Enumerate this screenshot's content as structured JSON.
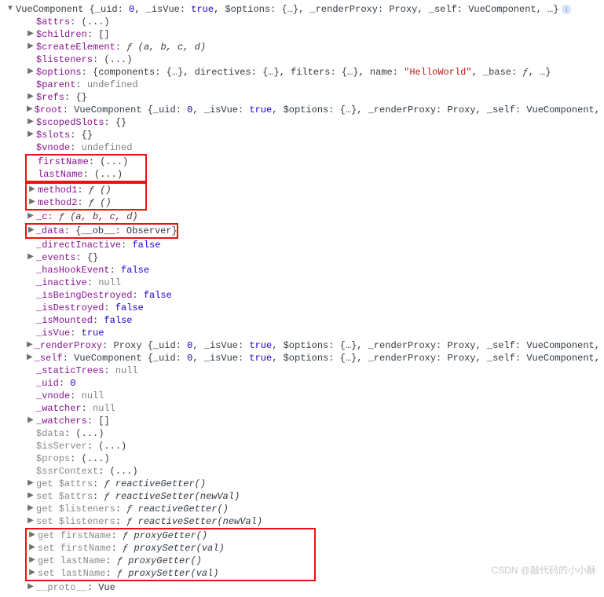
{
  "watermark": "CSDN @敲代码的小小酥",
  "header": {
    "name": "VueComponent",
    "parts": [
      {
        "k": "_uid",
        "v": "0",
        "cls": "num"
      },
      {
        "k": "_isVue",
        "v": "true",
        "cls": "bool"
      },
      {
        "k": "$options",
        "v": "{…}",
        "cls": "val"
      },
      {
        "k": "_renderProxy",
        "v": "Proxy",
        "cls": "val"
      },
      {
        "k": "_self",
        "v": "VueComponent",
        "cls": "val"
      }
    ],
    "tail": ", …}"
  },
  "pre": [
    {
      "arrow": "none",
      "k": "$attrs",
      "v": "(...)",
      "kcls": "prop",
      "vcls": "val"
    },
    {
      "arrow": "right",
      "k": "$children",
      "v": "[]",
      "kcls": "prop",
      "vcls": "val"
    },
    {
      "arrow": "right",
      "k": "$createElement",
      "render": "fn",
      "sig": "(a, b, c, d)",
      "kcls": "prop"
    },
    {
      "arrow": "none",
      "k": "$listeners",
      "v": "(...)",
      "kcls": "prop",
      "vcls": "val"
    },
    {
      "arrow": "right",
      "k": "$options",
      "render": "options",
      "kcls": "prop"
    },
    {
      "arrow": "none",
      "k": "$parent",
      "v": "undefined",
      "kcls": "prop",
      "vcls": "nul"
    },
    {
      "arrow": "right",
      "k": "$refs",
      "v": "{}",
      "kcls": "prop",
      "vcls": "val"
    },
    {
      "arrow": "right",
      "k": "$root",
      "render": "vuecomp",
      "kcls": "prop"
    },
    {
      "arrow": "right",
      "k": "$scopedSlots",
      "v": "{}",
      "kcls": "prop",
      "vcls": "val"
    },
    {
      "arrow": "right",
      "k": "$slots",
      "v": "{}",
      "kcls": "prop",
      "vcls": "val"
    },
    {
      "arrow": "none",
      "k": "$vnode",
      "v": "undefined",
      "kcls": "prop",
      "vcls": "nul"
    }
  ],
  "options": {
    "parts": [
      {
        "k": "components",
        "v": "{…}"
      },
      {
        "k": "directives",
        "v": "{…}"
      },
      {
        "k": "filters",
        "v": "{…}"
      },
      {
        "k": "name",
        "v": "\"HelloWorld\"",
        "cls": "str"
      },
      {
        "k": "_base",
        "v": "ƒ",
        "cls": "fn"
      }
    ],
    "tail": ", …}"
  },
  "vuecomp": {
    "name": "VueComponent",
    "parts": [
      {
        "k": "_uid",
        "v": "0",
        "cls": "num"
      },
      {
        "k": "_isVue",
        "v": "true",
        "cls": "bool"
      },
      {
        "k": "$options",
        "v": "{…}",
        "cls": "val"
      },
      {
        "k": "_renderProxy",
        "v": "Proxy",
        "cls": "val"
      },
      {
        "k": "_self",
        "v": "VueComponent",
        "cls": "val"
      }
    ],
    "tail": ", …}"
  },
  "box1": [
    {
      "arrow": "none",
      "k": "firstName",
      "v": "(...)",
      "kcls": "prop",
      "vcls": "val"
    },
    {
      "arrow": "none",
      "k": "lastName",
      "v": "(...)",
      "kcls": "prop",
      "vcls": "val"
    }
  ],
  "box2": [
    {
      "arrow": "right",
      "k": "method1",
      "render": "fn",
      "sig": "()",
      "kcls": "prop"
    },
    {
      "arrow": "right",
      "k": "method2",
      "render": "fn",
      "sig": "()",
      "kcls": "prop"
    }
  ],
  "mid1": [
    {
      "arrow": "right",
      "k": "_c",
      "render": "fn",
      "sig": "(a, b, c, d)",
      "kcls": "prop"
    }
  ],
  "box3": [
    {
      "arrow": "right",
      "k": "_data",
      "v": "{__ob__: Observer}",
      "kcls": "prop",
      "vcls": "val"
    }
  ],
  "mid2": [
    {
      "arrow": "none",
      "k": "_directInactive",
      "v": "false",
      "kcls": "prop",
      "vcls": "bool"
    },
    {
      "arrow": "right",
      "k": "_events",
      "v": "{}",
      "kcls": "prop",
      "vcls": "val"
    },
    {
      "arrow": "none",
      "k": "_hasHookEvent",
      "v": "false",
      "kcls": "prop",
      "vcls": "bool"
    },
    {
      "arrow": "none",
      "k": "_inactive",
      "v": "null",
      "kcls": "prop",
      "vcls": "nul"
    },
    {
      "arrow": "none",
      "k": "_isBeingDestroyed",
      "v": "false",
      "kcls": "prop",
      "vcls": "bool"
    },
    {
      "arrow": "none",
      "k": "_isDestroyed",
      "v": "false",
      "kcls": "prop",
      "vcls": "bool"
    },
    {
      "arrow": "none",
      "k": "_isMounted",
      "v": "false",
      "kcls": "prop",
      "vcls": "bool"
    },
    {
      "arrow": "none",
      "k": "_isVue",
      "v": "true",
      "kcls": "prop",
      "vcls": "bool"
    },
    {
      "arrow": "right",
      "k": "_renderProxy",
      "render": "proxycomp",
      "kcls": "prop"
    },
    {
      "arrow": "right",
      "k": "_self",
      "render": "vuecomp",
      "kcls": "prop"
    },
    {
      "arrow": "none",
      "k": "_staticTrees",
      "v": "null",
      "kcls": "prop",
      "vcls": "nul"
    },
    {
      "arrow": "none",
      "k": "_uid",
      "v": "0",
      "kcls": "prop",
      "vcls": "num"
    },
    {
      "arrow": "none",
      "k": "_vnode",
      "v": "null",
      "kcls": "prop",
      "vcls": "nul"
    },
    {
      "arrow": "none",
      "k": "_watcher",
      "v": "null",
      "kcls": "prop",
      "vcls": "nul"
    },
    {
      "arrow": "right",
      "k": "_watchers",
      "v": "[]",
      "kcls": "prop",
      "vcls": "val"
    },
    {
      "arrow": "none",
      "k": "$data",
      "v": "(...)",
      "kcls": "dim",
      "vcls": "val"
    },
    {
      "arrow": "none",
      "k": "$isServer",
      "v": "(...)",
      "kcls": "dim",
      "vcls": "val"
    },
    {
      "arrow": "none",
      "k": "$props",
      "v": "(...)",
      "kcls": "dim",
      "vcls": "val"
    },
    {
      "arrow": "none",
      "k": "$ssrContext",
      "v": "(...)",
      "kcls": "dim",
      "vcls": "val"
    },
    {
      "arrow": "right",
      "pre": "get ",
      "k": "$attrs",
      "render": "fn2",
      "sig": "reactiveGetter()",
      "kcls": "dim"
    },
    {
      "arrow": "right",
      "pre": "set ",
      "k": "$attrs",
      "render": "fn2",
      "sig": "reactiveSetter(newVal)",
      "kcls": "dim"
    },
    {
      "arrow": "right",
      "pre": "get ",
      "k": "$listeners",
      "render": "fn2",
      "sig": "reactiveGetter()",
      "kcls": "dim"
    },
    {
      "arrow": "right",
      "pre": "set ",
      "k": "$listeners",
      "render": "fn2",
      "sig": "reactiveSetter(newVal)",
      "kcls": "dim"
    }
  ],
  "proxycomp": {
    "name": "Proxy",
    "parts": [
      {
        "k": "_uid",
        "v": "0",
        "cls": "num"
      },
      {
        "k": "_isVue",
        "v": "true",
        "cls": "bool"
      },
      {
        "k": "$options",
        "v": "{…}",
        "cls": "val"
      },
      {
        "k": "_renderProxy",
        "v": "Proxy",
        "cls": "val"
      },
      {
        "k": "_self",
        "v": "VueComponent",
        "cls": "val"
      }
    ],
    "tail": ", …}"
  },
  "box4": [
    {
      "arrow": "right",
      "pre": "get ",
      "k": "firstName",
      "render": "fn2",
      "sig": "proxyGetter()",
      "kcls": "dim"
    },
    {
      "arrow": "right",
      "pre": "set ",
      "k": "firstName",
      "render": "fn2",
      "sig": "proxySetter(val)",
      "kcls": "dim"
    },
    {
      "arrow": "right",
      "pre": "get ",
      "k": "lastName",
      "render": "fn2",
      "sig": "proxyGetter()",
      "kcls": "dim"
    },
    {
      "arrow": "right",
      "pre": "set ",
      "k": "lastName",
      "render": "fn2",
      "sig": "proxySetter(val)",
      "kcls": "dim"
    }
  ],
  "post": [
    {
      "arrow": "right",
      "k": "__proto__",
      "v": "Vue",
      "kcls": "dim",
      "vcls": "val"
    }
  ],
  "box_widths": {
    "b1": 155,
    "b2": 155,
    "b3": 195,
    "b4": 370
  }
}
